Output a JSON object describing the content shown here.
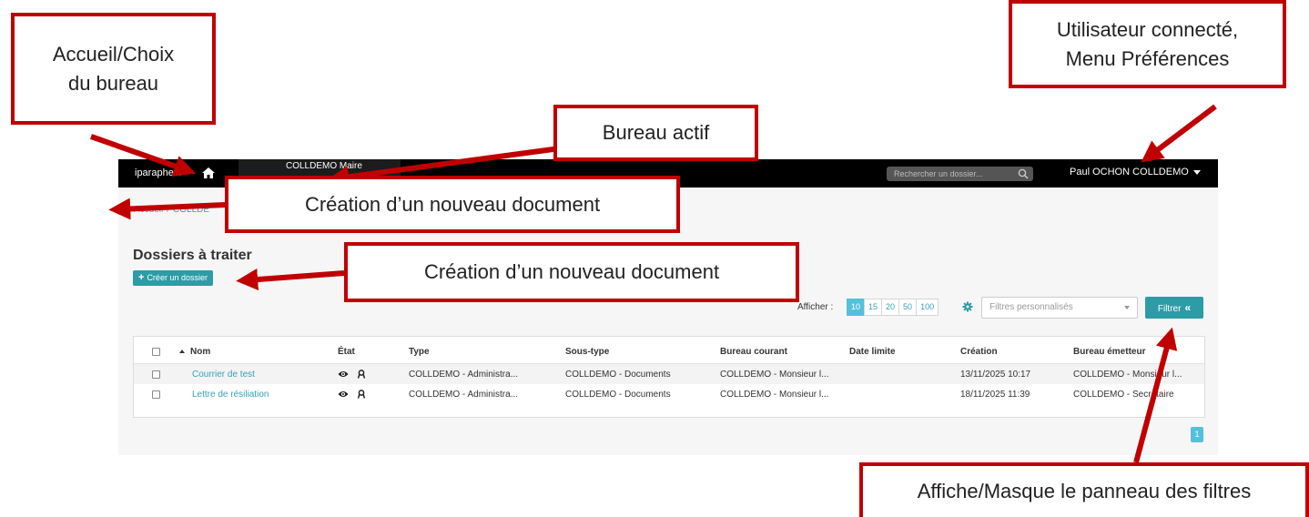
{
  "navbar": {
    "brand": "iparapheur",
    "active_desk": "COLLDEMO Maire",
    "search_placeholder": "Rechercher un dossier...",
    "user": "Paul OCHON COLLDEMO"
  },
  "breadcrumb": {
    "home": "Accueil",
    "current": "COLLDE"
  },
  "main": {
    "title": "Dossiers à traiter",
    "create_button": "Créer un dossier",
    "afficher_label": "Afficher :",
    "page_sizes": [
      "10",
      "15",
      "20",
      "50",
      "100"
    ],
    "active_page_size": "10",
    "filter_placeholder": "Filtres personnalisés",
    "filter_button": "Filtrer",
    "current_page": "1"
  },
  "table": {
    "columns": [
      "Nom",
      "État",
      "Type",
      "Sous-type",
      "Bureau courant",
      "Date limite",
      "Création",
      "Bureau émetteur"
    ],
    "rows": [
      {
        "nom": "Courrier de test",
        "type": "COLLDEMO - Administra...",
        "sous_type": "COLLDEMO - Documents",
        "bureau_courant": "COLLDEMO - Monsieur l...",
        "date_limite": "",
        "creation": "13/11/2025 10:17",
        "bureau_emetteur": "COLLDEMO - Monsieur l..."
      },
      {
        "nom": "Lettre de résiliation",
        "type": "COLLDEMO - Administra...",
        "sous_type": "COLLDEMO - Documents",
        "bureau_courant": "COLLDEMO - Monsieur l...",
        "date_limite": "",
        "creation": "18/11/2025 11:39",
        "bureau_emetteur": "COLLDEMO - Secrétaire"
      }
    ]
  },
  "annotations": {
    "home": "Accueil/Choix du bureau",
    "user": "Utilisateur connecté, Menu Préférences",
    "active_desk": "Bureau actif",
    "new_doc_1": "Création d’un nouveau document",
    "new_doc_2": "Création d’un nouveau document",
    "filters": "Affiche/Masque le panneau des filtres"
  },
  "colors": {
    "accent": "#2d9ca6",
    "link": "#3a9fb4",
    "annotation_red": "#c00000",
    "navbar": "#000000"
  }
}
